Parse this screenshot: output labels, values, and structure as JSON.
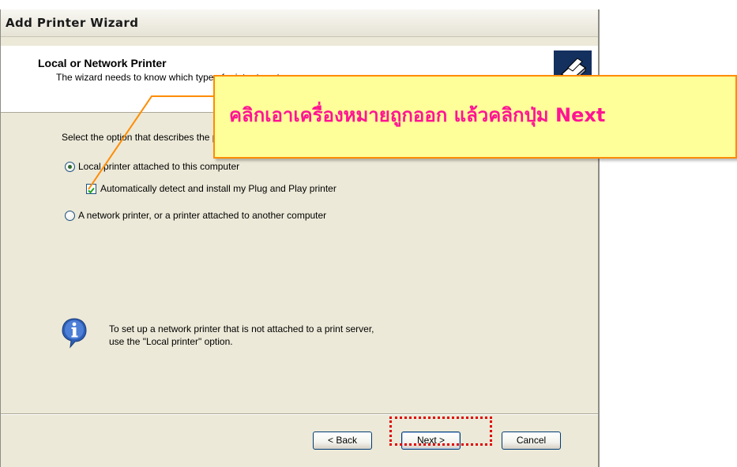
{
  "window": {
    "title": "Add Printer Wizard"
  },
  "header": {
    "title": "Local or Network Printer",
    "subtitle": "The wizard needs to know which type of printer to set up.",
    "icon": "printer-wizard-icon"
  },
  "body": {
    "prompt": "Select the option that describes the printer you want to use:",
    "options": [
      {
        "label": "Local printer attached to this computer",
        "selected": true
      },
      {
        "label": "A network printer, or a printer attached to another computer",
        "selected": false
      }
    ],
    "checkbox": {
      "label": "Automatically detect and install my Plug and Play printer",
      "checked": true
    },
    "info_icon": "info-icon",
    "info_line1": "To set up a network printer that is not attached to a print server,",
    "info_line2": "use the \"Local printer\" option."
  },
  "buttons": {
    "back": "< Back",
    "next": "Next >",
    "cancel": "Cancel"
  },
  "callout": {
    "text": "คลิกเอาเครื่องหมายถูกออก  แล้วคลิกปุ่ม Next"
  },
  "colors": {
    "callout_bg": "#ffff99",
    "callout_border": "#ff8c00",
    "callout_text": "#ff1493",
    "highlight": "#e00000",
    "checkmark": "#21a121"
  }
}
